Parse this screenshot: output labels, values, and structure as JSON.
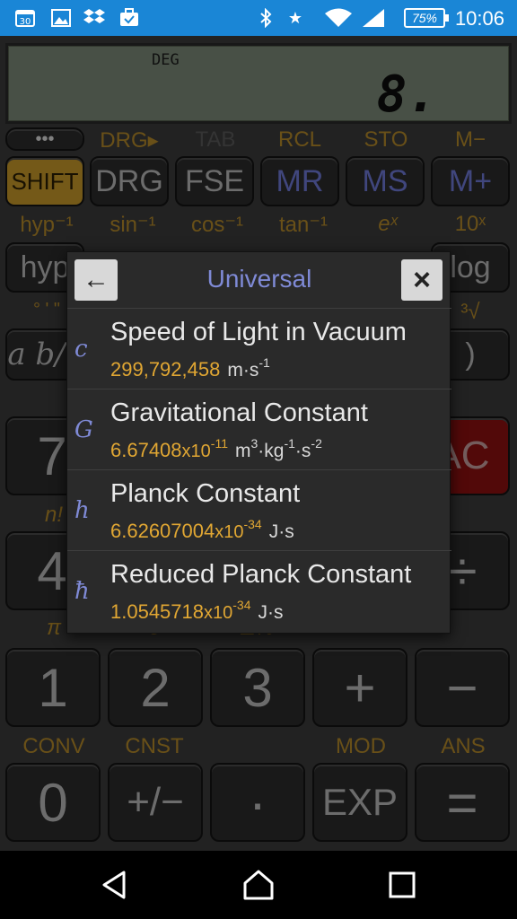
{
  "status_bar": {
    "time": "10:06",
    "battery": "75%",
    "icons": [
      "calendar-icon",
      "image-icon",
      "dropbox-icon",
      "briefcase-icon",
      "bluetooth-icon",
      "star-icon",
      "wifi-icon",
      "signal-icon"
    ]
  },
  "display": {
    "mode": "DEG",
    "value": "8."
  },
  "rows": {
    "row0_labels": [
      "DRG▸",
      "TAB",
      "RCL",
      "STO",
      "M−"
    ],
    "row0_dots": "•••",
    "row0_keys": [
      "SHIFT",
      "DRG",
      "FSE",
      "MR",
      "MS",
      "M+"
    ],
    "row1_labels": [
      "hyp⁻¹",
      "sin⁻¹",
      "cos⁻¹",
      "tan⁻¹",
      "eˣ",
      "10ˣ"
    ],
    "row1_keys": [
      "hyp",
      "log"
    ],
    "row2_labels": [
      "° ' \"",
      "³√"
    ],
    "row2_keys": [
      "a b/c",
      ")"
    ],
    "row3_keys": [
      "7",
      "AC"
    ],
    "row3_labels": [
      "n!"
    ],
    "row4_keys": [
      "4",
      "÷"
    ],
    "row5_labels": [
      "π",
      "c",
      "Δ%"
    ],
    "row5_keys": [
      "1",
      "2",
      "3",
      "+",
      "−"
    ],
    "row6_labels": [
      "CONV",
      "CNST",
      "",
      "MOD",
      "ANS"
    ],
    "row6_keys": [
      "0",
      "+/−",
      "·",
      "EXP",
      "="
    ]
  },
  "popup": {
    "title": "Universal",
    "back": "←",
    "close": "×",
    "constants": [
      {
        "symbol": "c",
        "name": "Speed of Light in Vacuum",
        "mantissa": "299,792,458",
        "x10": "",
        "exp": "",
        "unit": "m·s",
        "unit_sup": "-1"
      },
      {
        "symbol": "G",
        "name": "Gravitational Constant",
        "mantissa": "6.67408",
        "x10": "x10",
        "exp": "-11",
        "unit_html": "m<sup>3</sup>·kg<sup>-1</sup>·s<sup>-2</sup>"
      },
      {
        "symbol": "h",
        "name": "Planck Constant",
        "mantissa": "6.62607004",
        "x10": "x10",
        "exp": "-34",
        "unit": "J·s",
        "unit_sup": ""
      },
      {
        "symbol": "ħ",
        "name": "Reduced Planck Constant",
        "mantissa": "1.0545718",
        "x10": "x10",
        "exp": "-34",
        "unit": "J·s",
        "unit_sup": ""
      }
    ]
  },
  "navbar": {
    "icons": [
      "back-icon",
      "home-icon",
      "recents-icon"
    ]
  }
}
